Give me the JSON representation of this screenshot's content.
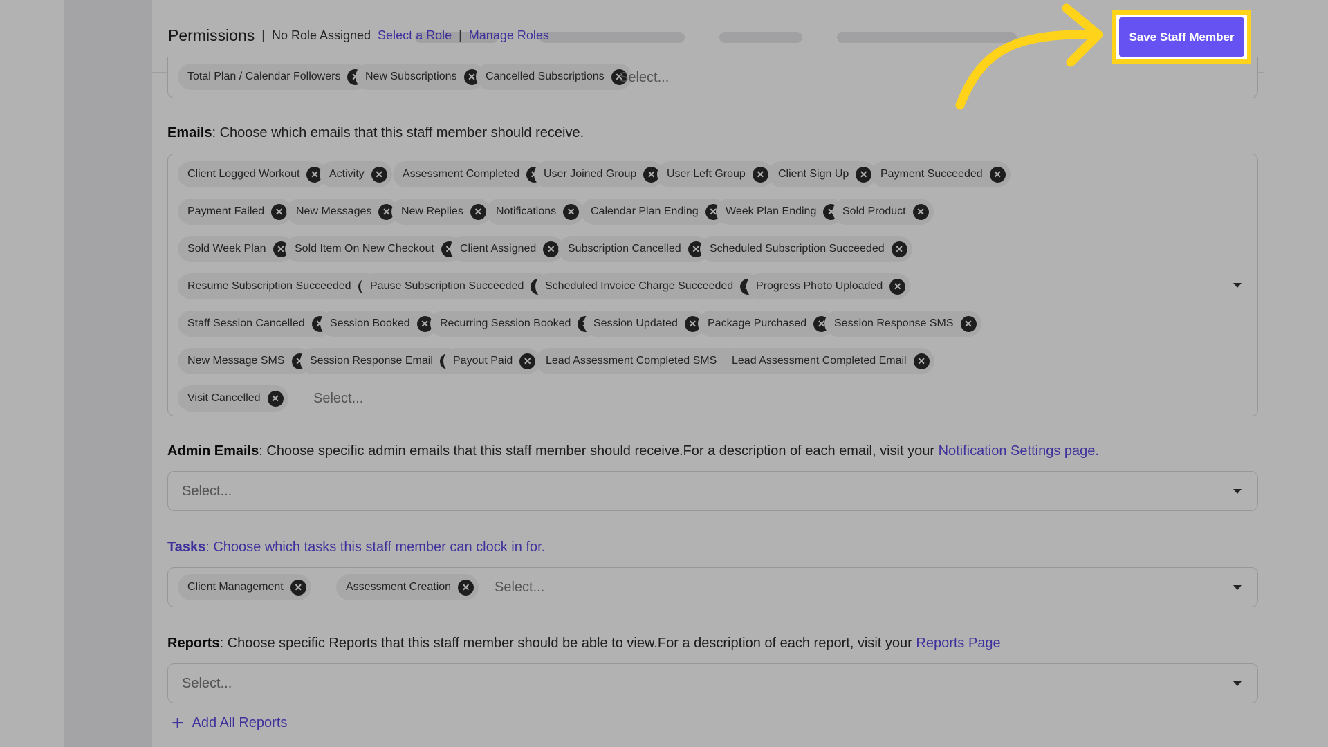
{
  "header": {
    "title": "Permissions",
    "separator": "|",
    "role_status": "No Role Assigned",
    "select_role_link": "Select a Role",
    "manage_roles_link": "Manage Roles",
    "save_button_label": "Save Staff Member"
  },
  "reports_tags": {
    "chips": [
      "Total Plan / Calendar Followers",
      "New Subscriptions",
      "Cancelled Subscriptions"
    ],
    "placeholder": "Select..."
  },
  "emails": {
    "label_bold": "Emails",
    "label_text": ": Choose which emails that this staff member should receive.",
    "chips": [
      "Client Logged Workout",
      "Activity",
      "Assessment Completed",
      "User Joined Group",
      "User Left Group",
      "Client Sign Up",
      "Payment Succeeded",
      "Payment Failed",
      "New Messages",
      "New Replies",
      "Notifications",
      "Calendar Plan Ending",
      "Week Plan Ending",
      "Sold Product",
      "Sold Week Plan",
      "Sold Item On New Checkout",
      "Client Assigned",
      "Subscription Cancelled",
      "Scheduled Subscription Succeeded",
      "Resume Subscription Succeeded",
      "Pause Subscription Succeeded",
      "Scheduled Invoice Charge Succeeded",
      "Progress Photo Uploaded",
      "Staff Session Cancelled",
      "Session Booked",
      "Recurring Session Booked",
      "Session Updated",
      "Package Purchased",
      "Session Response SMS",
      "New Message SMS",
      "Session Response Email",
      "Payout Paid",
      "Lead Assessment Completed SMS",
      "Lead Assessment Completed Email",
      "Visit Cancelled"
    ],
    "placeholder": "Select..."
  },
  "admin_emails": {
    "label_bold": "Admin Emails",
    "label_text": ": Choose specific admin emails that this staff member should receive.For a description of each email, visit your ",
    "link": "Notification Settings page.",
    "placeholder": "Select..."
  },
  "tasks": {
    "label_bold": "Tasks",
    "label_text": ": Choose which tasks this staff member can clock in for.",
    "chips": [
      "Client Management",
      "Assessment Creation"
    ],
    "placeholder": "Select..."
  },
  "reports": {
    "label_bold": "Reports",
    "label_text": ": Choose specific Reports that this staff member should be able to view.For a description of each report, visit your ",
    "link": "Reports Page",
    "placeholder": "Select...",
    "add_all": "Add All Reports"
  },
  "icons": {
    "remove": "close-icon",
    "dropdown": "chevron-down-icon",
    "add": "plus-icon",
    "pointer": "arrow-icon"
  },
  "colors": {
    "accent": "#6652f3",
    "link": "#5b47e0",
    "highlight": "#ffd31a",
    "dim_overlay": "rgba(0,0,0,0.30)"
  }
}
